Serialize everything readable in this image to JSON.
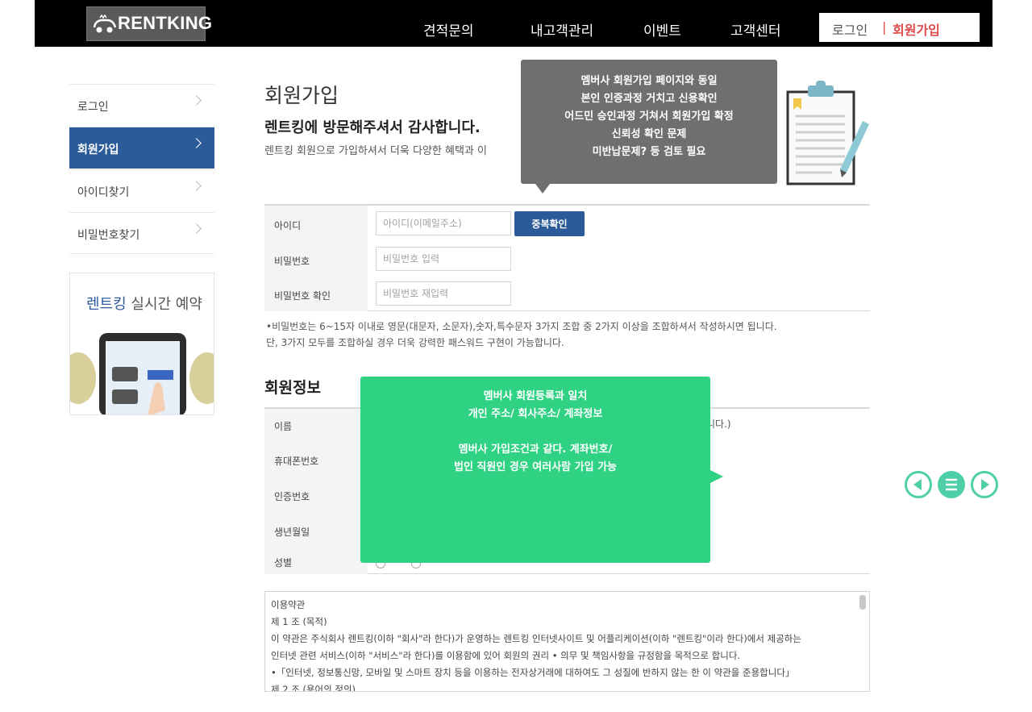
{
  "header": {
    "logo_text": "RENTKING",
    "nav": [
      "견적문의",
      "내고객관리",
      "이벤트",
      "고객센터"
    ],
    "login": "로그인",
    "separator": "|",
    "signup": "회원가입"
  },
  "sidebar": {
    "items": [
      {
        "label": "로그인"
      },
      {
        "label": "회원가입"
      },
      {
        "label": "아이디찾기"
      },
      {
        "label": "비밀번호찾기"
      }
    ],
    "banner_title_brand": "렌트킹",
    "banner_title_rest": " 실시간 예약"
  },
  "main": {
    "title": "회원가입",
    "subtitle": "렌트킹에 방문해주셔서 감사합니다.",
    "desc": "렌트킹 회원으로 가입하셔서 더욱 다양한 혜택과 이"
  },
  "form": {
    "id_label": "아이디",
    "id_placeholder": "아이디(이메일주소)",
    "dup_button": "중복확인",
    "pw_label": "비밀번호",
    "pw_placeholder": "비밀번호 입력",
    "pw2_label": "비밀번호 확인",
    "pw2_placeholder": "비밀번호 재입력"
  },
  "password_notes": [
    "•비밀번호는 6~15자 이내로 영문(대문자, 소문자),숫자,특수문자 3가지 조합 중 2가지 이상을 조합하셔서 작성하시면 됩니다.",
    "단, 3가지 모두를 조합하실 경우 더욱 강력한 패스워드 구현이 가능합니다."
  ],
  "info": {
    "title": "회원정보",
    "labels": [
      "이름",
      "휴대폰번호",
      "인증번호",
      "생년월일",
      "성별"
    ],
    "right_text": "니다.)"
  },
  "terms": {
    "lines": [
      "이용약관",
      "제 1 조 (목적)",
      "이 약관은 주식회사 렌트킹(이하 \"회사\"라 한다)가 운영하는 렌트킹 인터넷사이트 및 어플리케이션(이하 \"렌트킹\"이라 한다)에서 제공하는",
      "인터넷 관련 서비스(이하 \"서비스\"라 한다)를 이용함에 있어 회원의 권리 • 의무 및 책임사항을 규정함을 목적으로 합니다.",
      "•「인터넷, 정보통신망, 모바일 및 스마트 장치 등을 이용하는 전자상거래에 대하여도 그 성질에 반하지 않는 한 이 약관을 준용합니다」",
      "제 2 조 (용어의 정의)"
    ]
  },
  "callouts": {
    "gray": [
      "멤버사 회원가입 페이지와 동일",
      "본인 인증과정 거치고 신용확인",
      "어드민 승인과정 거쳐서 회원가입 확정",
      "신뢰성 확인 문제",
      "미반납문제? 등 검토 필요"
    ],
    "green": [
      "멤버사 회원등록과 일치",
      "개인 주소/ 회사주소/ 계좌정보",
      "",
      "멤버사 가입조건과 같다. 계좌번호/",
      "법인 직원인 경우 여러사람 가입 가능"
    ]
  },
  "colors": {
    "header_bg": "#000000",
    "active_blue": "#2c5b9a",
    "signup_red": "#e04a4a",
    "callout_gray": "#6f6f6f",
    "callout_green": "#2fd183",
    "nav_teal": "#4fcfa7"
  }
}
